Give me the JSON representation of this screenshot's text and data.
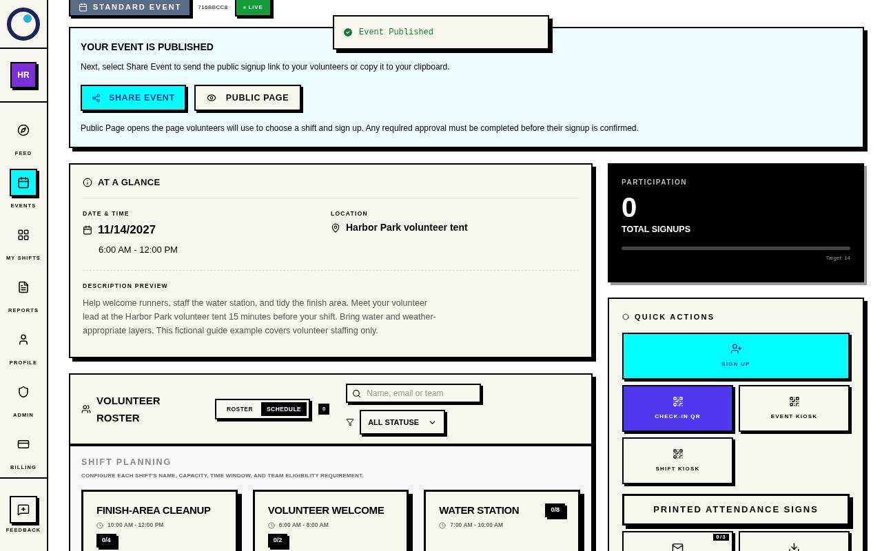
{
  "sidebar": {
    "avatar": "HR",
    "items": [
      {
        "label": "FEED",
        "selected": false
      },
      {
        "label": "EVENTS",
        "selected": true
      },
      {
        "label": "MY SHIFTS",
        "selected": false
      },
      {
        "label": "REPORTS",
        "selected": false
      },
      {
        "label": "PROFILE",
        "selected": false
      },
      {
        "label": "ADMIN",
        "selected": false
      },
      {
        "label": "BILLING",
        "selected": false
      }
    ],
    "feedback": "FEEDBACK"
  },
  "header": {
    "type_badge": "STANDARD EVENT",
    "code": "716BBCC8",
    "status": "LIVE"
  },
  "toast": {
    "message": "Event Published"
  },
  "published": {
    "title": "YOUR EVENT IS PUBLISHED",
    "text": "Next, select Share Event to send the public signup link to your volunteers or copy it to your clipboard.",
    "buttons": [
      "SHARE EVENT",
      "PUBLIC PAGE"
    ],
    "note": "Public Page opens the page volunteers will use to choose a shift and sign up. Any required approval must be completed before their signup is confirmed."
  },
  "glance": {
    "title": "AT A GLANCE",
    "date_label": "DATE & TIME",
    "date": "11/14/2027",
    "time": "6:00 AM - 12:00 PM",
    "location_label": "LOCATION",
    "location": "Harbor Park volunteer tent",
    "description_label": "DESCRIPTION PREVIEW",
    "description": "Help welcome runners, staff the water station, and tidy the finish area. Meet your volunteer lead at the Harbor Park volunteer tent 15 minutes before your shift. Bring water and weather-appropriate layers. This fictional guide example covers volunteer staffing only."
  },
  "participation": {
    "title": "PARTICIPATION",
    "count": "0",
    "label": "TOTAL SIGNUPS",
    "level": 0,
    "target": "Target: 14"
  },
  "roster": {
    "title": "VOLUNTEER ROSTER",
    "views": [
      {
        "label": "ROSTER",
        "selected": false
      },
      {
        "label": "SCHEDULE",
        "selected": true
      }
    ],
    "count": "0",
    "search": {
      "placeholder": "Name, email or team"
    },
    "status_filter": "ALL STATUSE",
    "planning_title": "SHIFT PLANNING",
    "planning_note": "CONFIGURE EACH SHIFT'S NAME, CAPACITY, TIME WINDOW, AND TEAM ELIGIBILITY REQUIREMENT.",
    "shifts": [
      {
        "name": "FINISH-AREA CLEANUP",
        "time": "10:00 AM - 12:00 PM",
        "filled": "0/4",
        "badge_inline": false
      },
      {
        "name": "VOLUNTEER WELCOME",
        "time": "6:00 AM - 8:00 AM",
        "filled": "0/2",
        "badge_inline": false
      },
      {
        "name": "WATER STATION",
        "time": "7:00 AM - 10:00 AM",
        "filled": "0/8",
        "badge_inline": true
      }
    ]
  },
  "quick_actions": {
    "title": "QUICK ACTIONS",
    "actions": [
      {
        "kind": "signup",
        "label": "SIGN UP"
      },
      {
        "kind": "qr",
        "label": "CHECK-IN QR",
        "highlight": true
      },
      {
        "kind": "qr",
        "label": "EVENT KIOSK",
        "highlight": false
      },
      {
        "kind": "qr",
        "label": "SHIFT KIOSK",
        "highlight": false
      },
      {
        "kind": "wide",
        "label": "PRINTED ATTENDANCE SIGNS"
      },
      {
        "kind": "mail",
        "badge": "0/3"
      },
      {
        "kind": "download"
      }
    ]
  }
}
